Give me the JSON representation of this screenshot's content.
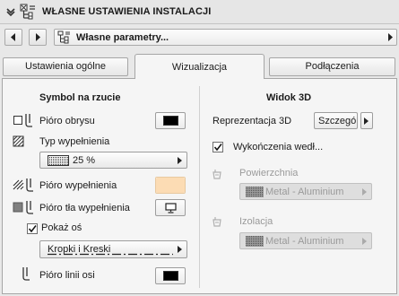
{
  "header": {
    "title": "WŁASNE USTAWIENIA INSTALACJI"
  },
  "nav": {
    "preset": "Własne parametry..."
  },
  "tabs": [
    {
      "label": "Ustawienia ogólne"
    },
    {
      "label": "Wizualizacja"
    },
    {
      "label": "Podłączenia"
    }
  ],
  "active_tab": "Wizualizacja",
  "symbol": {
    "title": "Symbol na rzucie",
    "contour_pen": "Pióro obrysu",
    "fill_type": "Typ wypełnienia",
    "fill_value": "25 %",
    "fill_pen": "Pióro wypełnienia",
    "bg_pen": "Pióro tła wypełnienia",
    "show_axis": "Pokaż oś",
    "line_type": "Kropki i Kreski",
    "axis_pen": "Pióro linii osi"
  },
  "view3d": {
    "title": "Widok 3D",
    "repr_label": "Reprezentacja 3D",
    "repr_value": "Szczegó",
    "finishes": "Wykończenia wedł...",
    "surface_label": "Powierzchnia",
    "surface_value": "Metal - Aluminium",
    "insulation_label": "Izolacja",
    "insulation_value": "Metal - Aluminium"
  },
  "colors": {
    "fill_pen_color": "#fcdcb4",
    "pen_color": "#000000"
  }
}
